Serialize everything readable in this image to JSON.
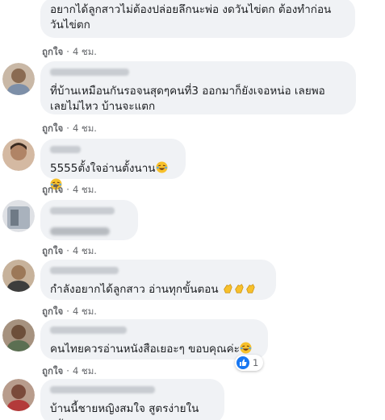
{
  "comments": [
    {
      "text_line1": "อยากได้ลูกสาวไม่ต้องปล่อยลึกนะพ่อ งดวันไข่ตก ต้องทำก่อน",
      "text_line2": "วันไข่ตก",
      "like": "ถูกใจ",
      "time": "4 ชม."
    },
    {
      "text_line1": "ที่บ้านเหมือนกันรอจนสุดๆคนที่3 ออกมาก็ยังเจอหน่อ เลยพอ",
      "text_line2": "เลยไม่ไหว บ้านจะแตก",
      "like": "ถูกใจ",
      "time": "4 ชม."
    },
    {
      "text": "5555ตั้งใจอ่านตั้งนาน",
      "like": "ถูกใจ",
      "time": "4 ชม."
    },
    {
      "like": "ถูกใจ",
      "time": "4 ชม."
    },
    {
      "text": "กำลังอยากได้ลูกสาว อ่านทุกขั้นตอน",
      "like": "ถูกใจ",
      "time": "4 ชม."
    },
    {
      "text": "คนไทยควรอ่านหนังสือเยอะๆ ขอบคุณค่ะ",
      "like": "ถูกใจ",
      "time": "4 ชม.",
      "reaction_count": "1"
    },
    {
      "text": "บ้านนี้ชายหญิงสมใจ สูตรง่ายในครัว"
    }
  ],
  "meta_separator": "·",
  "colors": {
    "bubble": "#f0f2f5",
    "meta": "#65676b",
    "like_blue": "#1877f2"
  }
}
